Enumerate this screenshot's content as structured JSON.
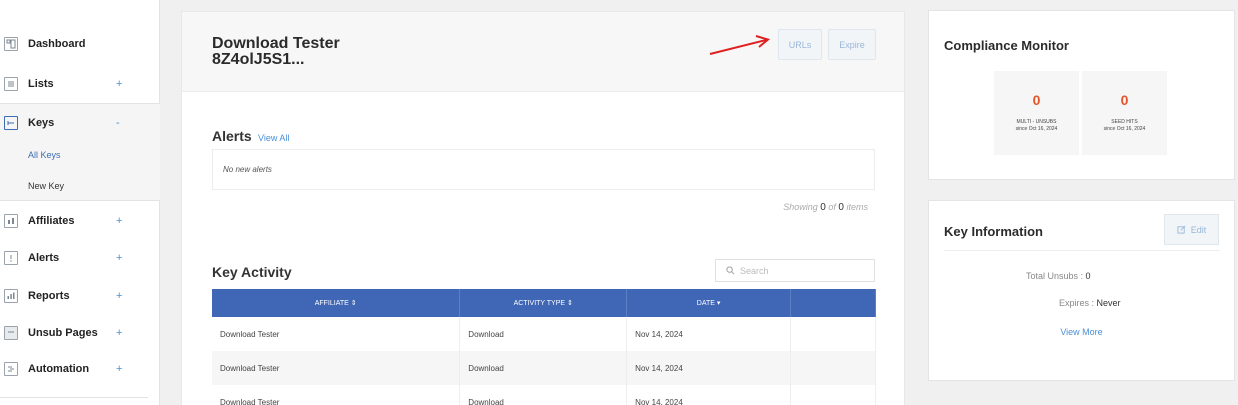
{
  "sidebar": {
    "items": [
      {
        "label": "Dashboard",
        "icon": "dashboard-icon",
        "plus": ""
      },
      {
        "label": "Lists",
        "icon": "list-icon",
        "plus": "+"
      },
      {
        "label": "Keys",
        "icon": "key-icon",
        "plus": "-"
      },
      {
        "label": "Affiliates",
        "icon": "affiliates-icon",
        "plus": "+"
      },
      {
        "label": "Alerts",
        "icon": "alert-icon",
        "plus": "+"
      },
      {
        "label": "Reports",
        "icon": "reports-icon",
        "plus": "+"
      },
      {
        "label": "Unsub Pages",
        "icon": "unsub-pages-icon",
        "plus": "+"
      },
      {
        "label": "Automation",
        "icon": "automation-icon",
        "plus": "+"
      }
    ],
    "keys_sub": {
      "all_keys": "All Keys",
      "new_key": "New Key"
    }
  },
  "main": {
    "title_line1": "Download Tester",
    "title_line2": "8Z4olJ5S1...",
    "urls_button": "URLs",
    "expire_button": "Expire",
    "alerts": {
      "title": "Alerts",
      "view_all": "View All",
      "empty": "No new alerts",
      "showing_prefix": "Showing",
      "showing_count": "0",
      "showing_of": "of",
      "showing_total": "0",
      "showing_suffix": "items"
    },
    "activity": {
      "title": "Key Activity",
      "search_placeholder": "Search",
      "columns": [
        "AFFILIATE ⇕",
        "ACTIVITY TYPE ⇕",
        "DATE ▾",
        ""
      ],
      "rows": [
        [
          "Download Tester",
          "Download",
          "Nov 14, 2024",
          ""
        ],
        [
          "Download Tester",
          "Download",
          "Nov 14, 2024",
          ""
        ],
        [
          "Download Tester",
          "Download",
          "Nov 14, 2024",
          ""
        ]
      ]
    }
  },
  "compliance": {
    "title": "Compliance Monitor",
    "stats": [
      {
        "value": "0",
        "label": "MULTI - UNSUBS",
        "since": "since Oct 16, 2024"
      },
      {
        "value": "0",
        "label": "SEED HITS",
        "since": "since Oct 16, 2024"
      }
    ]
  },
  "key_info": {
    "title": "Key Information",
    "edit_button": "Edit",
    "total_unsubs_label": "Total Unsubs :",
    "total_unsubs_value": "0",
    "expires_label": "Expires :",
    "expires_value": "Never",
    "view_more": "View More"
  },
  "colors": {
    "accent": "#3f67b5",
    "stat": "#e0552a",
    "link": "#4a8fd6",
    "annotation_arrow": "#e02020"
  }
}
